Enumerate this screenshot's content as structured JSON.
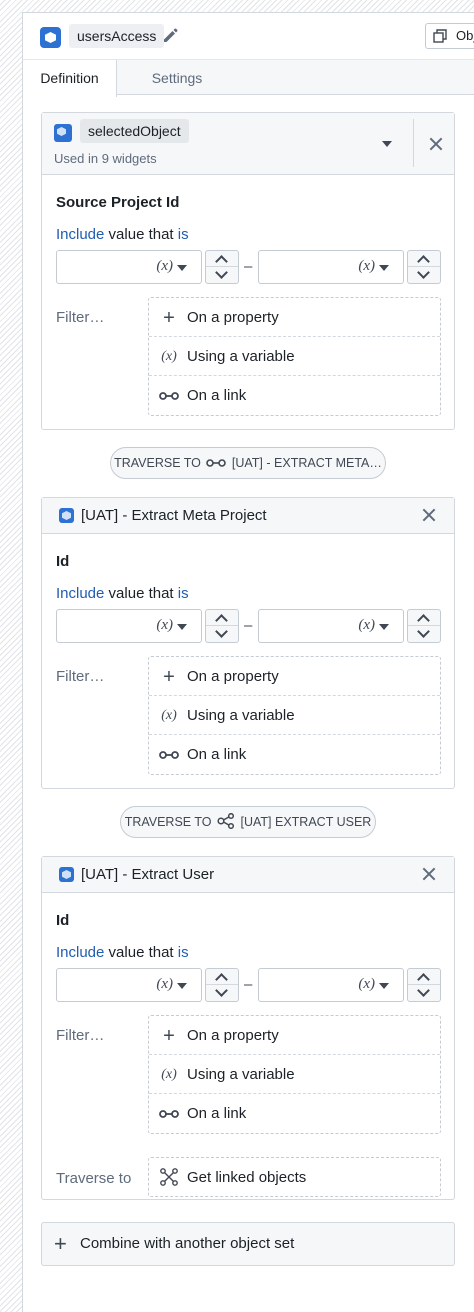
{
  "header": {
    "variable_name": "usersAccess",
    "object_button_label": "Obj"
  },
  "tabs": [
    {
      "label": "Definition",
      "active": true
    },
    {
      "label": "Settings",
      "active": false
    }
  ],
  "source": {
    "selected_object": "selectedObject",
    "used_in_prefix": "Used in",
    "used_in_count": "9 widgets",
    "field_title": "Source Project Id"
  },
  "cards": [
    {
      "title": "[UAT] - Extract Meta Project",
      "field_title": "Id"
    },
    {
      "title": "[UAT] - Extract User",
      "field_title": "Id"
    }
  ],
  "common": {
    "include_word": "Include",
    "value_that": "value that",
    "is_word": "is",
    "variable_token": "(x)",
    "range_dash": "–",
    "filter_label": "Filter…",
    "filter_options": [
      "On a property",
      "Using a variable",
      "On a link"
    ],
    "traverse_label": "Traverse to",
    "traverse_option": "Get linked objects"
  },
  "traversals": [
    "TRAVERSE TO ⊶ [UAT] - EXTRACT META…",
    "TRAVERSE TO [UAT] EXTRACT USER"
  ],
  "traversal_parts": [
    {
      "prefix": "TRAVERSE TO",
      "target": "[UAT] - EXTRACT META…"
    },
    {
      "prefix": "TRAVERSE TO",
      "target": "[UAT] EXTRACT USER"
    }
  ],
  "footer": {
    "combine_label": "Combine with another object set"
  },
  "colors": {
    "accent": "#2d72d2",
    "link_blue": "#215db0",
    "panel_bg": "#f6f7f9",
    "border": "#d3d8de"
  }
}
